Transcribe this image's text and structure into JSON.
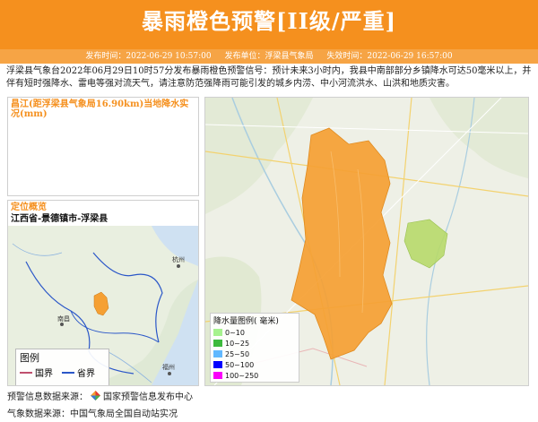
{
  "header": {
    "title": "暴雨橙色预警[II级/严重]",
    "publish_time": "发布时间：2022-06-29 10:57:00",
    "publisher": "发布单位：浮梁县气象局",
    "expire_time": "失效时间：2022-06-29 16:57:00"
  },
  "description": "浮梁县气象台2022年06月29日10时57分发布暴雨橙色预警信号：预计未来3小时内，我县中南部部分乡镇降水可达50毫米以上，并伴有短时强降水、雷电等强对流天气，请注意防范强降雨可能引发的城乡内涝、中小河流洪水、山洪和地质灾害。",
  "rainfall_panel": {
    "title": "昌江(距浮梁县气象局16.90km)当地降水实况(mm)"
  },
  "location_panel": {
    "title": "定位概览",
    "region": "江西省-景德镇市-浮梁县",
    "map_labels": {
      "city1": "杭州",
      "city2": "南昌",
      "city3": "福州"
    },
    "legend": {
      "title": "图例",
      "items": [
        {
          "label": "国界",
          "color": "#c0506e"
        },
        {
          "label": "省界",
          "color": "#2b57c8"
        }
      ]
    }
  },
  "main_map": {
    "legend": {
      "title": "降水量图例( 毫米)",
      "items": [
        {
          "label": "0~10",
          "color": "#a6f28f"
        },
        {
          "label": "10~25",
          "color": "#3dba3d"
        },
        {
          "label": "25~50",
          "color": "#61b8ff"
        },
        {
          "label": "50~100",
          "color": "#0000ff"
        },
        {
          "label": "100~250",
          "color": "#fa00fa"
        }
      ]
    },
    "warning_color": "#f5a033",
    "light_rain_color": "#b7d96a"
  },
  "footer": {
    "source1_label": "预警信息数据来源：",
    "source1_value": "国家预警信息发布中心",
    "source2": "气象数据来源：中国气象局全国自动站实况"
  }
}
